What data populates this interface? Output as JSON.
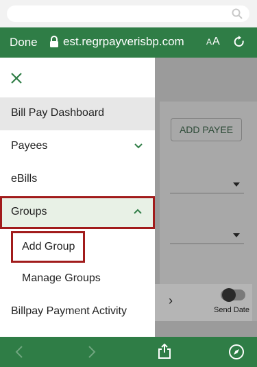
{
  "browser": {
    "done_label": "Done",
    "url": "est.regrpayverisbp.com",
    "text_size_label_big": "A",
    "text_size_label_small": "A"
  },
  "drawer": {
    "items": [
      {
        "label": "Bill Pay Dashboard"
      },
      {
        "label": "Payees"
      },
      {
        "label": "eBills"
      },
      {
        "label": "Groups"
      },
      {
        "label": "Add Group"
      },
      {
        "label": "Manage Groups"
      },
      {
        "label": "Billpay Payment Activity"
      }
    ]
  },
  "background": {
    "add_payee_label": "ADD PAYEE",
    "send_date_label": "Send Date",
    "row_chevron": "›"
  },
  "colors": {
    "brand_green": "#2f7d46",
    "highlight_red": "#a11b1b",
    "groups_bg": "#e8f1e6"
  }
}
